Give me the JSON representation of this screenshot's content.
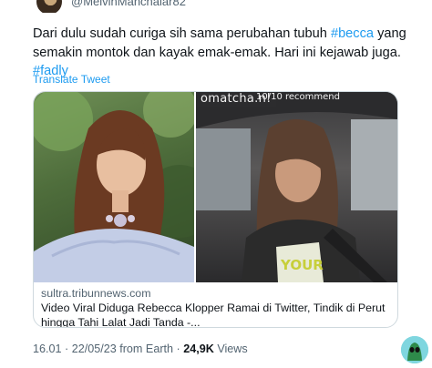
{
  "author": {
    "handle": "@MelvinManchaiar82"
  },
  "tweet": {
    "text_part1": "Dari dulu sudah curiga sih sama perubahan tubuh ",
    "hashtag1": "#becca",
    "text_part2": " yang semakin montok dan kayak emak-emak. Hari ini kejawab juga. ",
    "hashtag2": "#fadly",
    "translate_label": "Translate Tweet"
  },
  "card": {
    "left_image_watermark": "",
    "right_image_watermark": "omatcha.n!",
    "right_image_overlay": "10/10 recommend",
    "domain": "sultra.tribunnews.com",
    "headline": "Video Viral Diduga Rebecca Klopper Ramai di Twitter, Tindik di Perut hingga Tahi Lalat Jadi Tanda -..."
  },
  "meta": {
    "time_date": "16.01 · 22/05/23 from Earth · ",
    "views_count": "24,9K",
    "views_label": " Views"
  },
  "colors": {
    "link": "#1d9bf0",
    "text": "#0f1419",
    "secondary": "#536471",
    "border": "#cfd9de"
  }
}
